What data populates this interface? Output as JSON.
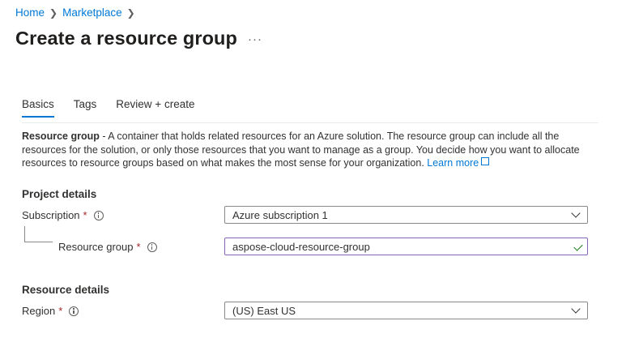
{
  "breadcrumb": {
    "items": [
      "Home",
      "Marketplace"
    ]
  },
  "page": {
    "title": "Create a resource group",
    "more_label": "···"
  },
  "tabs": [
    {
      "label": "Basics"
    },
    {
      "label": "Tags"
    },
    {
      "label": "Review + create"
    }
  ],
  "description": {
    "bold": "Resource group",
    "text": " - A container that holds related resources for an Azure solution. The resource group can include all the resources for the solution, or only those resources that you want to manage as a group. You decide how you want to allocate resources to resource groups based on what makes the most sense for your organization. ",
    "link": "Learn more"
  },
  "project_details": {
    "heading": "Project details",
    "subscription": {
      "label": "Subscription",
      "required": "*",
      "value": "Azure subscription 1"
    },
    "resource_group": {
      "label": "Resource group",
      "required": "*",
      "value": "aspose-cloud-resource-group"
    }
  },
  "resource_details": {
    "heading": "Resource details",
    "region": {
      "label": "Region",
      "required": "*",
      "value": "(US) East US"
    }
  },
  "colors": {
    "accent": "#0078d4",
    "required": "#a4262c",
    "valid_border": "#8764b8",
    "check": "#107c10"
  }
}
